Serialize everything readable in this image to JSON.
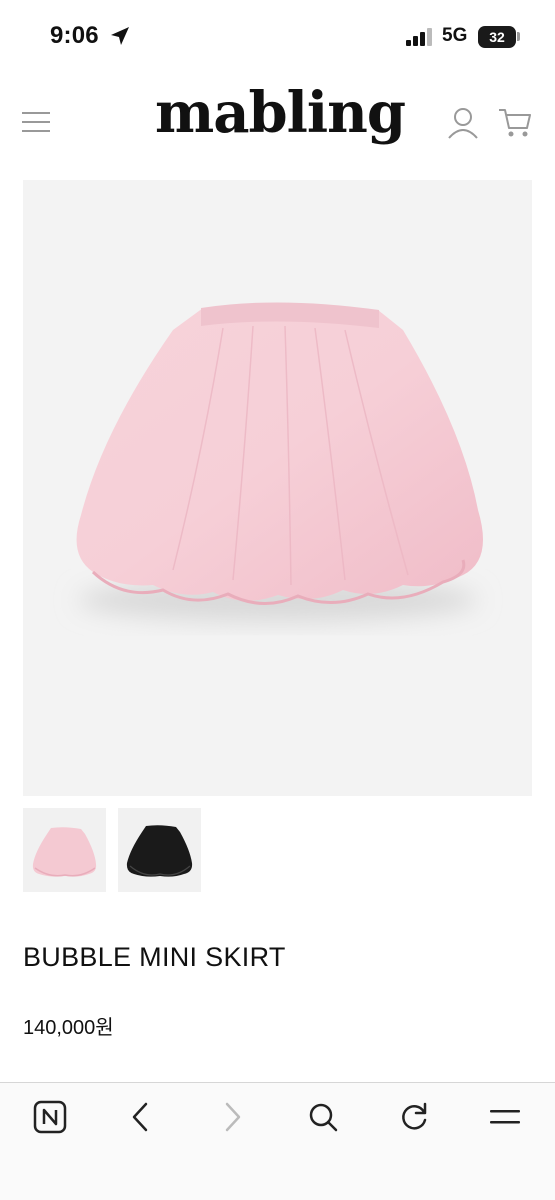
{
  "status_bar": {
    "time": "9:06",
    "network": "5G",
    "battery": "32"
  },
  "header": {
    "logo": "mabling"
  },
  "product": {
    "title": "BUBBLE MINI SKIRT",
    "price": "140,000원"
  },
  "colors": {
    "skirt_pink": "#f4c9d2",
    "skirt_black": "#1a1a1a",
    "background": "#f3f3f3"
  },
  "icons": [
    "location-arrow-icon",
    "signal-icon",
    "menu-icon",
    "user-icon",
    "cart-icon",
    "naver-icon",
    "back-icon",
    "forward-icon",
    "search-icon",
    "refresh-icon",
    "menu-lines-icon"
  ]
}
